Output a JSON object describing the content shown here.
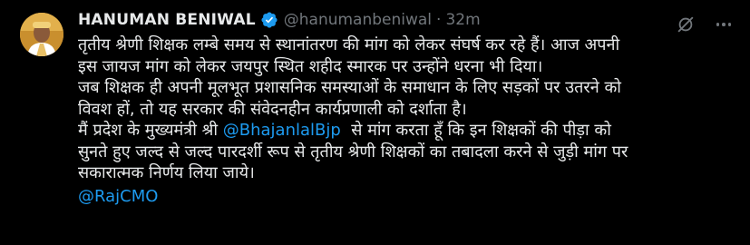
{
  "tweet": {
    "display_name": "HANUMAN BENIWAL",
    "handle": "@hanumanbeniwal",
    "separator": "·",
    "time": "32m",
    "verified": true,
    "colors": {
      "background": "#000000",
      "text": "#e7e9ea",
      "muted": "#71767b",
      "link": "#1d9bf0"
    },
    "icons": [
      "verified-badge-icon",
      "grok-icon",
      "more-options-icon"
    ],
    "body": {
      "line1": "तृतीय श्रेणी शिक्षक लम्बे समय से स्थानांतरण की मांग को लेकर संघर्ष कर रहे हैं। आज अपनी",
      "line2": "इस जायज मांग को लेकर जयपुर स्थित शहीद स्मारक पर उन्होंने धरना भी दिया।",
      "line3": "जब शिक्षक ही अपनी मूलभूत प्रशासनिक समस्याओं के समाधान के लिए सड़कों पर उतरने को",
      "line4": "विवश हों, तो यह सरकार की संवेदनहीन कार्यप्रणाली को दर्शाता है।",
      "line5_prefix": "मैं प्रदेश के मुख्यमंत्री श्री ",
      "line5_mention": "@BhajanlalBjp",
      "line5_suffix": "  से मांग करता हूँ कि इन शिक्षकों की पीड़ा को",
      "line6": "सुनते हुए जल्द से जल्द पारदर्शी रूप से तृतीय श्रेणी शिक्षकों का तबादला करने से जुड़ी मांग पर",
      "line7": "सकारात्मक निर्णय लिया जाये।",
      "mention_footer": "@RajCMO"
    }
  }
}
